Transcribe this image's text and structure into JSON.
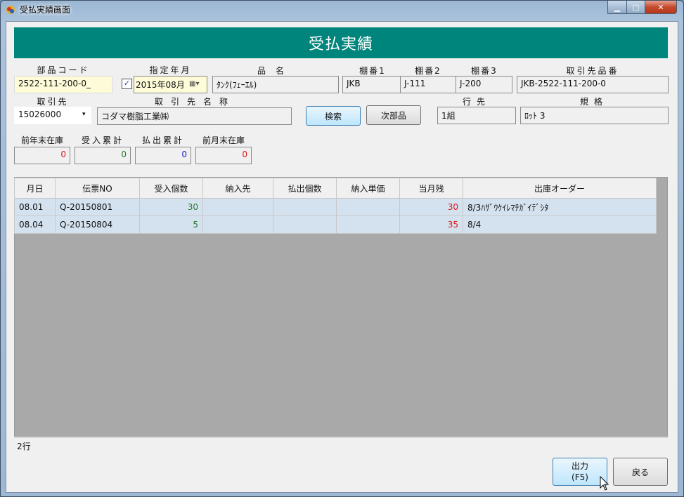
{
  "window": {
    "title": "受払実績画面",
    "buttons": {
      "minimize": "▁",
      "maximize": "▢",
      "close": "✕"
    }
  },
  "header": {
    "title": "受払実績"
  },
  "form": {
    "part_code": {
      "label": "部品コード",
      "value": "2522-111-200-0_"
    },
    "date": {
      "label": "指定年月",
      "value": "2015年08月",
      "checked": true
    },
    "product_name": {
      "label": "品名",
      "value": "ﾀﾝｸ(ﾌｪｰｴﾙ)"
    },
    "shelf1": {
      "label": "棚番1",
      "value": "JKB"
    },
    "shelf2": {
      "label": "棚番2",
      "value": "J-111"
    },
    "shelf3": {
      "label": "棚番3",
      "value": "J-200"
    },
    "supplier_part_no": {
      "label": "取引先品番",
      "value": "JKB-2522-111-200-0"
    },
    "supplier": {
      "label": "取引先",
      "value": "15026000"
    },
    "supplier_name": {
      "label": "取引先名称",
      "value": "コダマ樹脂工業㈱"
    },
    "search_button": "検索",
    "next_part_button": "次部品",
    "destination": {
      "label": "行先",
      "value": "1組"
    },
    "spec": {
      "label": "規格",
      "value": "ﾛｯﾄ 3"
    },
    "prev_year_stock": {
      "label": "前年末在庫",
      "value": "0"
    },
    "receipt_total": {
      "label": "受入累計",
      "value": "0"
    },
    "issue_total": {
      "label": "払出累計",
      "value": "0"
    },
    "prev_month_stock": {
      "label": "前月末在庫",
      "value": "0"
    }
  },
  "table": {
    "columns": [
      "月日",
      "伝票NO",
      "受入個数",
      "納入先",
      "払出個数",
      "納入単価",
      "当月残",
      "出庫オーダー"
    ],
    "rows": [
      [
        "08.01",
        "Q-20150801",
        "30",
        "",
        "",
        "",
        "30",
        "8/3ﾊｻﾞｳｹｲﾚﾏﾁｶﾞｲﾃﾞｼﾀ"
      ],
      [
        "08.04",
        "Q-20150804",
        "5",
        "",
        "",
        "",
        "35",
        "8/4"
      ]
    ]
  },
  "status": {
    "row_count": "2行"
  },
  "footer": {
    "output_button_line1": "出力",
    "output_button_line2": "(F5)",
    "back_button": "戻る"
  },
  "colors": {
    "header": "#00857c",
    "row": "#d4e2f0",
    "grid_bg": "#a9a9a9"
  }
}
